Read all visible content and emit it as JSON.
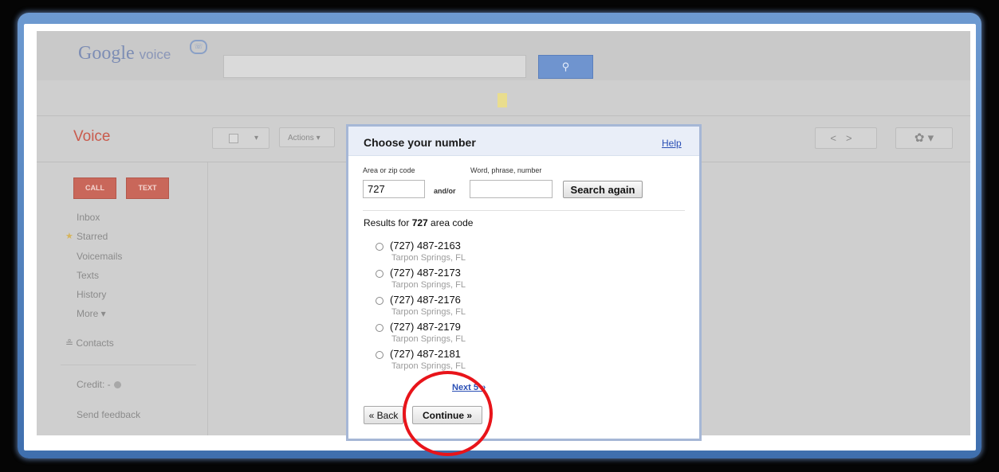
{
  "header": {
    "logo_google": "Google",
    "logo_voice": "voice",
    "search_icon": "search-icon"
  },
  "toolbar": {
    "section_title": "Voice",
    "actions_label": "Actions",
    "actions_caret": "▾",
    "check_caret": "▾",
    "nav_prev": "<",
    "nav_next": ">",
    "gear_glyph": "✿",
    "gear_caret": "▾"
  },
  "sidebar": {
    "call_label": "CALL",
    "text_label": "TEXT",
    "items": [
      {
        "label": "Inbox"
      },
      {
        "label": "Starred"
      },
      {
        "label": "Voicemails"
      },
      {
        "label": "Texts"
      },
      {
        "label": "History"
      },
      {
        "label": "More ▾"
      }
    ],
    "contacts_label": "Contacts",
    "credit_label": "Credit: -",
    "feedback_label": "Send feedback"
  },
  "dialog": {
    "title": "Choose your number",
    "help_label": "Help",
    "area_label": "Area or zip code",
    "word_label": "Word, phrase, number",
    "area_value": "727",
    "andor_label": "and/or",
    "word_value": "",
    "search_again_label": "Search again",
    "results_prefix": "Results for ",
    "results_code": "727",
    "results_suffix": " area code",
    "results": [
      {
        "number": "(727) 487-2163",
        "location": "Tarpon Springs, FL"
      },
      {
        "number": "(727) 487-2173",
        "location": "Tarpon Springs, FL"
      },
      {
        "number": "(727) 487-2176",
        "location": "Tarpon Springs, FL"
      },
      {
        "number": "(727) 487-2179",
        "location": "Tarpon Springs, FL"
      },
      {
        "number": "(727) 487-2181",
        "location": "Tarpon Springs, FL"
      }
    ],
    "next_label": "Next 5 »",
    "back_label": "« Back",
    "continue_label": "Continue »"
  },
  "annotation": {
    "highlight_color": "#e8141a"
  }
}
